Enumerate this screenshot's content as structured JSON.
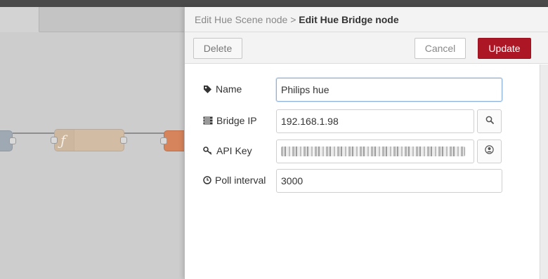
{
  "header": {
    "parent_crumb": "Edit Hue Scene node",
    "separator": " > ",
    "current_crumb": "Edit Hue Bridge node"
  },
  "toolbar": {
    "delete_label": "Delete",
    "cancel_label": "Cancel",
    "update_label": "Update"
  },
  "form": {
    "name": {
      "label": "Name",
      "icon": "tag-icon",
      "value": "Philips hue"
    },
    "bridge_ip": {
      "label": "Bridge IP",
      "icon": "server-icon",
      "value": "192.168.1.98",
      "action_icon": "search-icon"
    },
    "api_key": {
      "label": "API Key",
      "icon": "key-icon",
      "action_icon": "user-circle-icon"
    },
    "poll_interval": {
      "label": "Poll interval",
      "icon": "clock-icon",
      "value": "3000"
    }
  },
  "workspace": {
    "function_icon": "ƒ"
  },
  "colors": {
    "update_button": "#ad1625",
    "function_node": "#d2bca3",
    "output_node": "#d6845b",
    "input_node": "#9fa9b3"
  }
}
